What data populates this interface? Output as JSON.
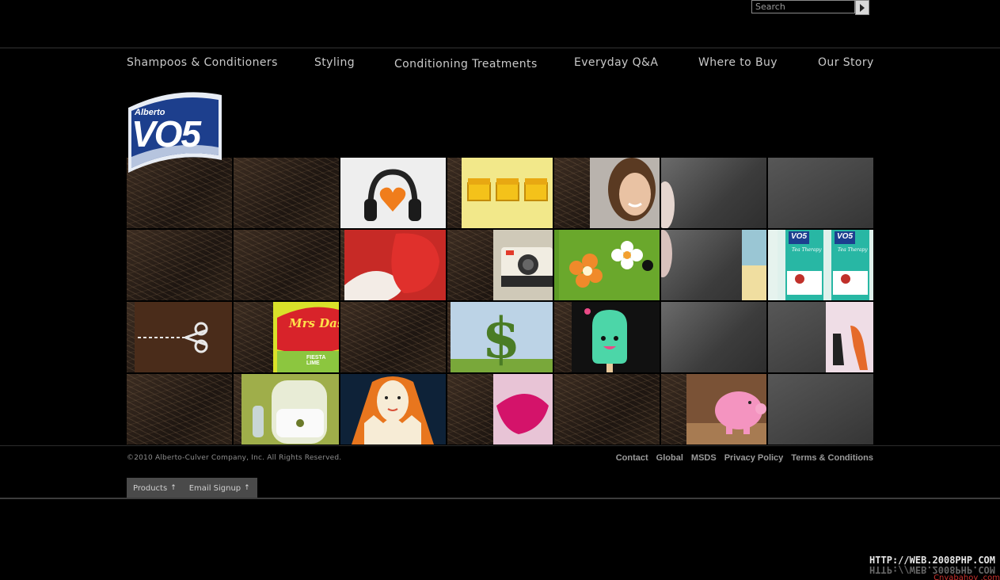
{
  "search": {
    "placeholder": "Search"
  },
  "nav": {
    "items": [
      "Shampoos & Conditioners",
      "Styling",
      "Conditioning Treatments",
      "Everyday Q&A",
      "Where to Buy",
      "Our Story"
    ]
  },
  "logo": {
    "brand_small": "Alberto",
    "brand_big": "VO5"
  },
  "tiles": {
    "package_brand": "VO5",
    "package_line": "Tea Therapy",
    "box_brand": "Mrs Dash",
    "box_flavor": "FIESTA LIME"
  },
  "footer": {
    "copyright": "©2010 Alberto-Culver Company, Inc. All Rights Reserved.",
    "links": [
      "Contact",
      "Global",
      "MSDS",
      "Privacy Policy",
      "Terms & Conditions"
    ],
    "tabs": [
      "Products",
      "Email Signup"
    ]
  },
  "watermark": {
    "text": "HTTP://WEB.2008PHP.COM",
    "sub": "Cnyabahoy .com"
  }
}
